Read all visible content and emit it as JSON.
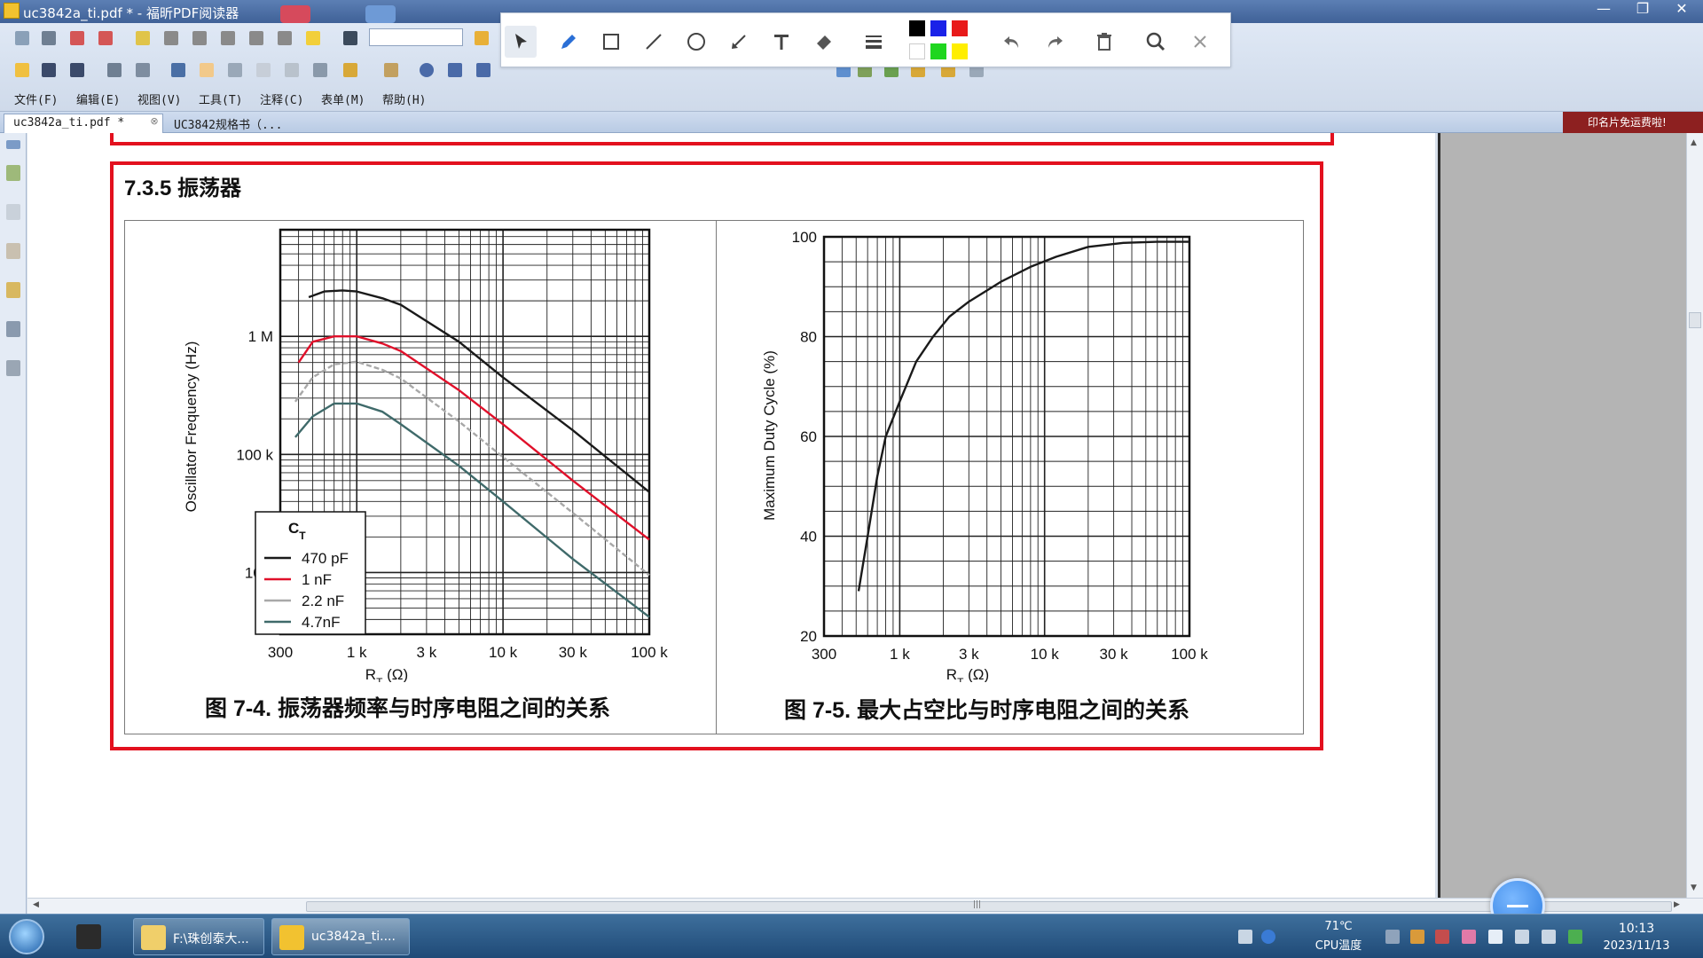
{
  "window": {
    "title": "uc3842a_ti.pdf * - 福昕PDF阅读器"
  },
  "menu": [
    "文件(F)",
    "编辑(E)",
    "视图(V)",
    "工具(T)",
    "注释(C)",
    "表单(M)",
    "帮助(H)"
  ],
  "tabs": [
    {
      "label": "uc3842a_ti.pdf *",
      "active": true
    },
    {
      "label": "UC3842规格书（..."
    }
  ],
  "ad_banner": "印名片免运费啦!",
  "annotation_palette": {
    "tools": [
      "select-tool",
      "pencil-tool",
      "rectangle-tool",
      "line-tool",
      "ellipse-tool",
      "arrow-tool",
      "text-tool",
      "eraser-tool",
      "line-weight-tool",
      "undo",
      "redo",
      "delete",
      "search",
      "close"
    ],
    "colors": [
      "#000000",
      "#1a22e8",
      "#e81a1a",
      "#ffffff",
      "#1fd61f",
      "#ffee00"
    ]
  },
  "document": {
    "section_title": "7.3.5 振荡器",
    "figure_left_caption": "图 7-4. 振荡器频率与时序电阻之间的关系",
    "figure_right_caption": "图 7-5. 最大占空比与时序电阻之间的关系"
  },
  "charts_text": {
    "left": {
      "ylabel": "Oscillator Frequency (Hz)",
      "xlabel_main": "R",
      "xlabel_sub": "T",
      "xlabel_unit": " (Ω)",
      "legend_title_main": "C",
      "legend_title_sub": "T"
    },
    "right": {
      "ylabel": "Maximum Duty Cycle (%)",
      "xlabel_main": "R",
      "xlabel_sub": "T",
      "xlabel_unit": " (Ω)"
    }
  },
  "chart_data": [
    {
      "type": "line",
      "xscale": "log",
      "yscale": "log",
      "xlim": [
        300,
        100000
      ],
      "ylim": [
        3000,
        8000000
      ],
      "x_ticks": [
        {
          "v": 300,
          "label": "300"
        },
        {
          "v": 1000,
          "label": "1 k"
        },
        {
          "v": 3000,
          "label": "3 k"
        },
        {
          "v": 10000,
          "label": "10 k"
        },
        {
          "v": 30000,
          "label": "30 k"
        },
        {
          "v": 100000,
          "label": "100 k"
        }
      ],
      "y_ticks": [
        {
          "v": 10000,
          "label": "10 k"
        },
        {
          "v": 100000,
          "label": "100 k"
        },
        {
          "v": 1000000,
          "label": "1 M"
        }
      ],
      "grid": true,
      "legend_position": "bottom-left",
      "series": [
        {
          "name": "470 pF",
          "color": "#1a1a1a",
          "x": [
            470,
            600,
            800,
            1000,
            1500,
            2000,
            5000,
            10000,
            30000,
            100000
          ],
          "y": [
            2150000,
            2400000,
            2450000,
            2400000,
            2100000,
            1850000,
            900000,
            450000,
            160000,
            48000
          ]
        },
        {
          "name": "1 nF",
          "color": "#e0102a",
          "x": [
            400,
            500,
            700,
            1000,
            1500,
            2000,
            5000,
            10000,
            30000,
            100000
          ],
          "y": [
            600000,
            900000,
            1000000,
            1000000,
            870000,
            750000,
            350000,
            180000,
            60000,
            19000
          ]
        },
        {
          "name": "2.2 nF",
          "color": "#a8a8a8",
          "x": [
            380,
            500,
            700,
            1000,
            1500,
            2000,
            5000,
            10000,
            30000,
            100000
          ],
          "y": [
            280000,
            450000,
            580000,
            610000,
            520000,
            440000,
            190000,
            95000,
            32000,
            9500
          ]
        },
        {
          "name": "4.7nF",
          "color": "#3f6a6a",
          "x": [
            380,
            500,
            700,
            1000,
            1500,
            2000,
            5000,
            10000,
            30000,
            100000
          ],
          "y": [
            140000,
            210000,
            270000,
            270000,
            230000,
            180000,
            80000,
            40000,
            13000,
            4200
          ]
        }
      ]
    },
    {
      "type": "line",
      "xscale": "log",
      "xlim": [
        300,
        100000
      ],
      "ylim": [
        20,
        100
      ],
      "x_ticks": [
        {
          "v": 300,
          "label": "300"
        },
        {
          "v": 1000,
          "label": "1 k"
        },
        {
          "v": 3000,
          "label": "3 k"
        },
        {
          "v": 10000,
          "label": "10 k"
        },
        {
          "v": 30000,
          "label": "30 k"
        },
        {
          "v": 100000,
          "label": "100 k"
        }
      ],
      "y_ticks": [
        {
          "v": 20,
          "label": "20"
        },
        {
          "v": 40,
          "label": "40"
        },
        {
          "v": 60,
          "label": "60"
        },
        {
          "v": 80,
          "label": "80"
        },
        {
          "v": 100,
          "label": "100"
        }
      ],
      "grid": true,
      "series": [
        {
          "color": "#1a1a1a",
          "x": [
            520,
            600,
            700,
            800,
            1000,
            1300,
            1700,
            2200,
            3000,
            5000,
            8000,
            12000,
            20000,
            35000,
            60000,
            100000
          ],
          "y": [
            29,
            40,
            52,
            60,
            67,
            75,
            80,
            84,
            87,
            91,
            94,
            96,
            98,
            98.8,
            99,
            99
          ]
        }
      ]
    }
  ],
  "taskbar": {
    "tasks": [
      {
        "label": "F:\\珠创泰大..."
      },
      {
        "label": "uc3842a_ti...."
      }
    ],
    "cpu_temp": "71℃",
    "cpu_label": "CPU温度",
    "time": "10:13",
    "date": "2023/11/13"
  }
}
